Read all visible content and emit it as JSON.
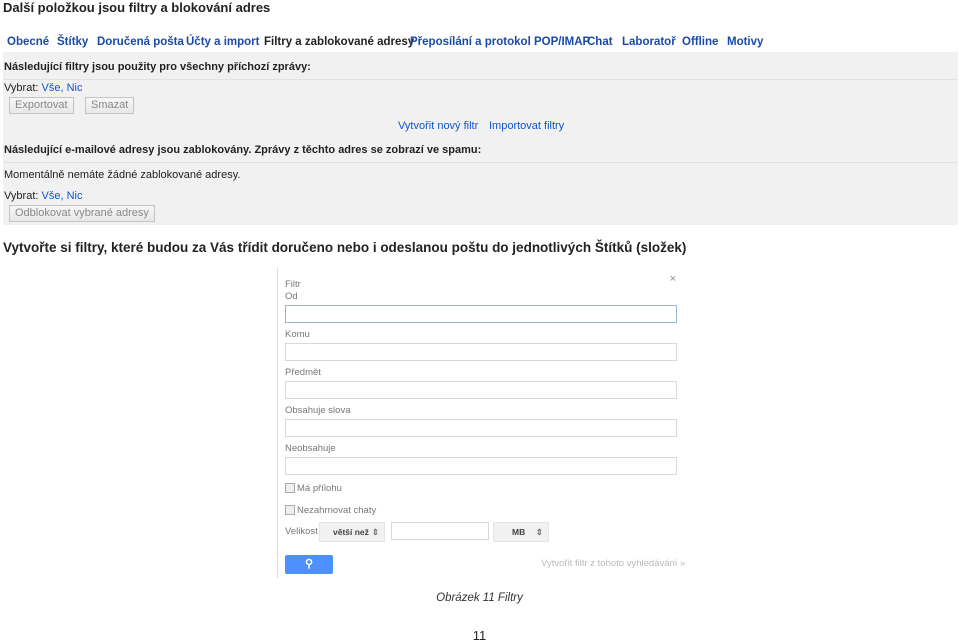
{
  "heading1": "Další položkou jsou filtry a blokování adres",
  "settings": {
    "tabs": [
      {
        "label": "Obecné"
      },
      {
        "label": "Štítky"
      },
      {
        "label": "Doručená pošta"
      },
      {
        "label": "Účty a import"
      },
      {
        "label": "Filtry a zablokované adresy",
        "active": true
      },
      {
        "label": "Přeposílání a protokol POP/IMAP"
      },
      {
        "label": "Chat"
      },
      {
        "label": "Laboratoř"
      },
      {
        "label": "Offline"
      },
      {
        "label": "Motivy"
      }
    ],
    "filters_heading": "Následující filtry jsou použity pro všechny příchozí zprávy:",
    "select_label": "Vybrat:",
    "select_all": "Vše,",
    "select_none": "Nic",
    "export_button": "Exportovat",
    "delete_button": "Smazat",
    "create_filter_link": "Vytvořit nový filtr",
    "import_filters_link": "Importovat filtry",
    "blocked_heading": "Následující e-mailové adresy jsou zablokovány. Zprávy z těchto adres se zobrazí ve spamu:",
    "blocked_empty": "Momentálně nemáte žádné zablokované adresy.",
    "unblock_button": "Odblokovat vybrané adresy"
  },
  "heading2": "Vytvořte si filtry, které budou za Vás třídit doručeno nebo i odeslanou poštu do jednotlivých Štítků (složek)",
  "filter_dialog": {
    "title": "Filtr",
    "close": "×",
    "from_label": "Od",
    "to_label": "Komu",
    "subject_label": "Předmět",
    "has_words_label": "Obsahuje slova",
    "doesnt_have_label": "Neobsahuje",
    "has_attachment": "Má přílohu",
    "exclude_chats": "Nezahrnovat chaty",
    "size_label": "Velikost",
    "size_operator": "větší než",
    "size_unit": "MB",
    "create_from_search": "Vytvořit filtr z tohoto vyhledávání »",
    "search_icon": "search-icon",
    "accent": "#4d90fe"
  },
  "caption": "Obrázek 11 Filtry",
  "page_number": "11"
}
